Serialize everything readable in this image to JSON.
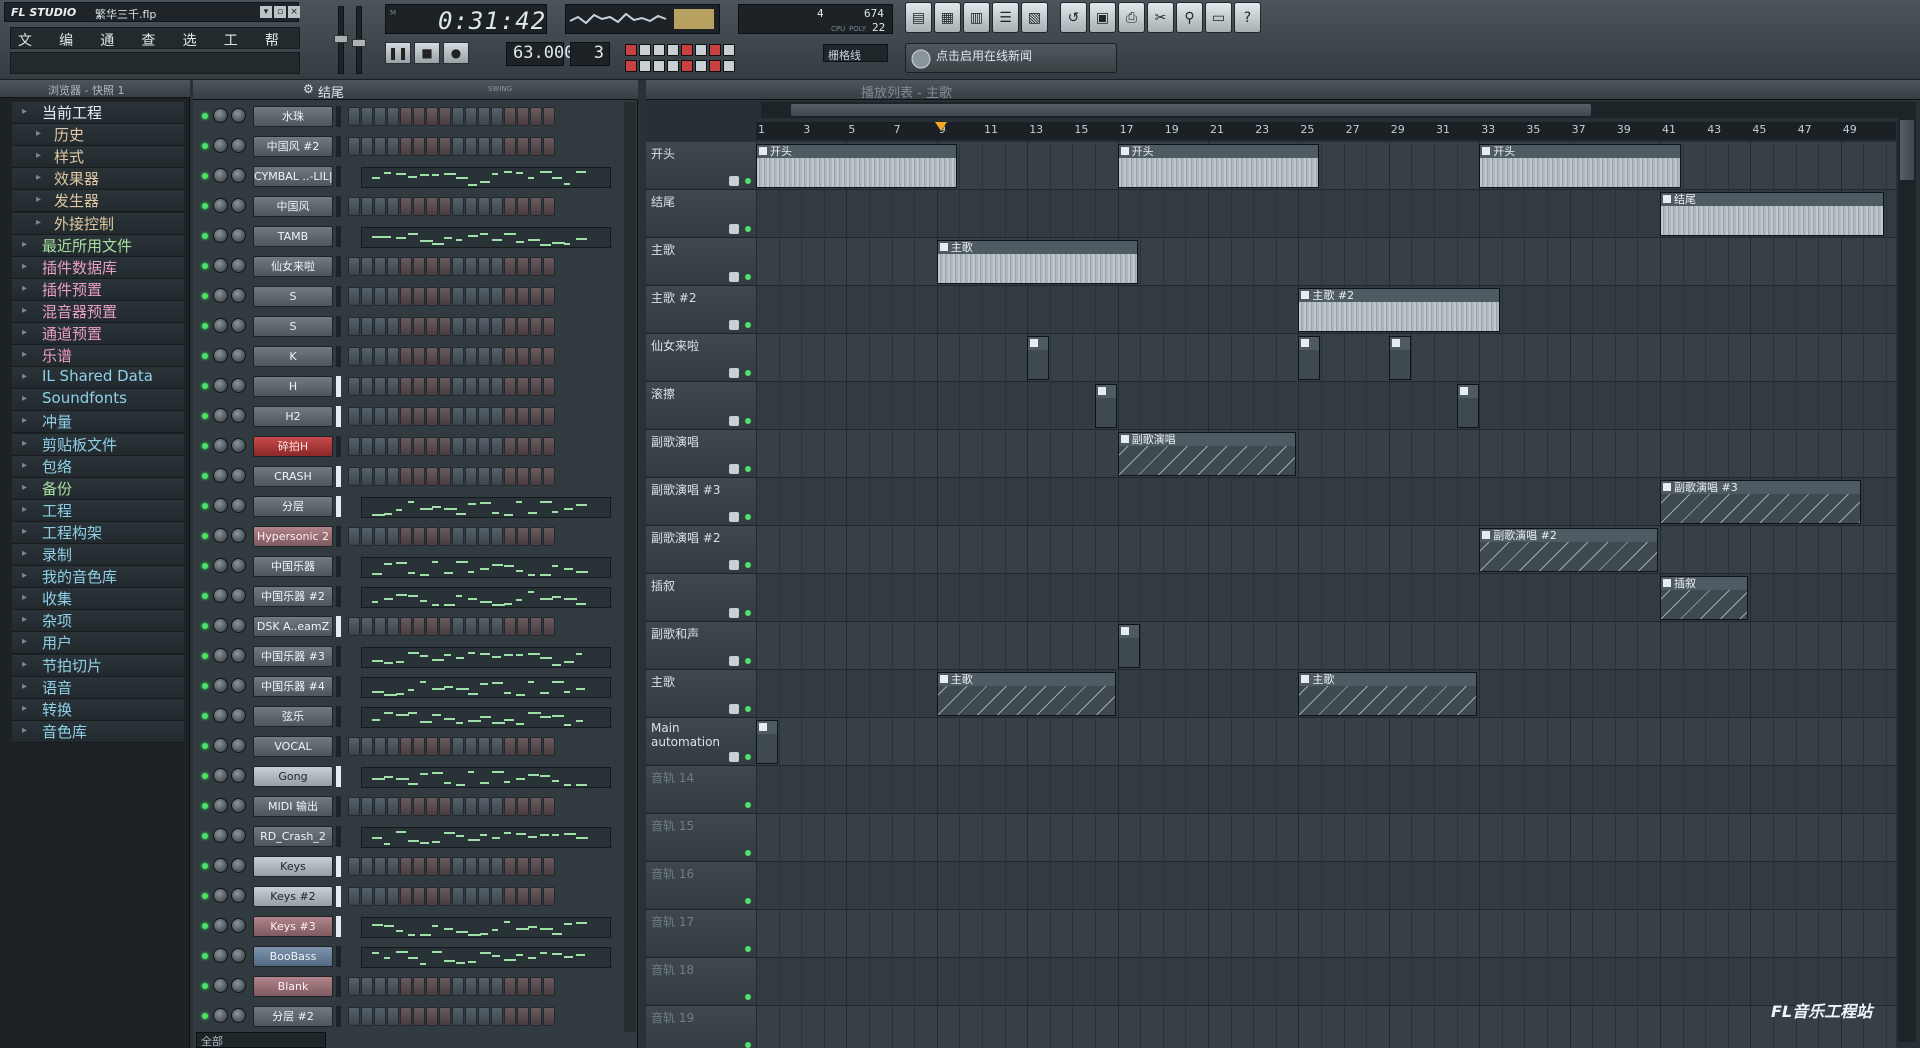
{
  "app": {
    "logo": "FL STUDIO",
    "project": "繁华三千.flp"
  },
  "menu": [
    "文件",
    "编辑",
    "通道",
    "查看",
    "选项",
    "工具",
    "帮助"
  ],
  "transport": {
    "time": "0:31:42",
    "tempo": "63.000",
    "pattern": "3",
    "tempo_label": "TEMPO",
    "pat_label": "PAT"
  },
  "cpu": {
    "a": "4",
    "b": "674",
    "c": "22",
    "mon": "MONITOR",
    "cpu_lbl": "CPU",
    "poly_lbl": "POLY"
  },
  "snap": {
    "label": "栅格线",
    "news": "点击启用在线新闻"
  },
  "browser": {
    "title": "浏览器 - 快照 1",
    "items": [
      {
        "label": "当前工程",
        "sub": false,
        "color": "#e6f0f4"
      },
      {
        "label": "历史",
        "sub": true,
        "color": "#e0c8a0"
      },
      {
        "label": "样式",
        "sub": true,
        "color": "#e0c8a0"
      },
      {
        "label": "效果器",
        "sub": true,
        "color": "#e0c8a0"
      },
      {
        "label": "发生器",
        "sub": true,
        "color": "#e0c8a0"
      },
      {
        "label": "外接控制",
        "sub": true,
        "color": "#e0c8a0"
      },
      {
        "label": "最近所用文件",
        "sub": false,
        "color": "#a8e0a0"
      },
      {
        "label": "插件数据库",
        "sub": false,
        "color": "#e8a0c0"
      },
      {
        "label": "插件预置",
        "sub": false,
        "color": "#e8a0c0"
      },
      {
        "label": "混音器预置",
        "sub": false,
        "color": "#e8a0c0"
      },
      {
        "label": "通道预置",
        "sub": false,
        "color": "#e8a0c0"
      },
      {
        "label": "乐谱",
        "sub": false,
        "color": "#e8a0c0"
      },
      {
        "label": "IL Shared Data",
        "sub": false,
        "color": "#8fd0e8"
      },
      {
        "label": "Soundfonts",
        "sub": false,
        "color": "#8fd0e8"
      },
      {
        "label": "冲量",
        "sub": false,
        "color": "#8fd0e8"
      },
      {
        "label": "剪贴板文件",
        "sub": false,
        "color": "#8fd0e8"
      },
      {
        "label": "包络",
        "sub": false,
        "color": "#8fd0e8"
      },
      {
        "label": "备份",
        "sub": false,
        "color": "#a8e0a0"
      },
      {
        "label": "工程",
        "sub": false,
        "color": "#8fd0e8"
      },
      {
        "label": "工程构架",
        "sub": false,
        "color": "#8fd0e8"
      },
      {
        "label": "录制",
        "sub": false,
        "color": "#8fd0e8"
      },
      {
        "label": "我的音色库",
        "sub": false,
        "color": "#8fd0e8"
      },
      {
        "label": "收集",
        "sub": false,
        "color": "#8fd0e8"
      },
      {
        "label": "杂项",
        "sub": false,
        "color": "#8fd0e8"
      },
      {
        "label": "用户",
        "sub": false,
        "color": "#8fd0e8"
      },
      {
        "label": "节拍切片",
        "sub": false,
        "color": "#8fd0e8"
      },
      {
        "label": "语音",
        "sub": false,
        "color": "#8fd0e8"
      },
      {
        "label": "转换",
        "sub": false,
        "color": "#8fd0e8"
      },
      {
        "label": "音色库",
        "sub": false,
        "color": "#8fd0e8"
      }
    ]
  },
  "rack": {
    "title": "结尾",
    "footer": "全部",
    "swing_label": "SWING",
    "channels": [
      {
        "name": "水珠",
        "style": "dark",
        "mode": "steps",
        "sel": false
      },
      {
        "name": "中国风 #2",
        "style": "dark",
        "mode": "steps",
        "sel": false
      },
      {
        "name": "CYMBAL ..-LIL|",
        "style": "dark",
        "mode": "roll",
        "sel": false
      },
      {
        "name": "中国风",
        "style": "dark",
        "mode": "steps",
        "sel": false
      },
      {
        "name": "TAMB",
        "style": "dark",
        "mode": "roll",
        "sel": false
      },
      {
        "name": "仙女来啦",
        "style": "dark",
        "mode": "steps",
        "sel": false
      },
      {
        "name": "S",
        "style": "dark",
        "mode": "steps",
        "sel": false
      },
      {
        "name": "S",
        "style": "dark",
        "mode": "steps",
        "sel": false
      },
      {
        "name": "K",
        "style": "dark",
        "mode": "steps",
        "sel": false
      },
      {
        "name": "H",
        "style": "dark",
        "mode": "steps",
        "sel": true
      },
      {
        "name": "H2",
        "style": "dark",
        "mode": "steps",
        "sel": true
      },
      {
        "name": "碎拍H",
        "style": "red",
        "mode": "steps",
        "sel": false
      },
      {
        "name": "CRASH",
        "style": "dark",
        "mode": "steps",
        "sel": true
      },
      {
        "name": "分层",
        "style": "dark",
        "mode": "roll",
        "sel": true
      },
      {
        "name": "Hypersonic 2",
        "style": "pink",
        "mode": "steps",
        "sel": false
      },
      {
        "name": "中国乐器",
        "style": "dark",
        "mode": "roll",
        "sel": false
      },
      {
        "name": "中国乐器 #2",
        "style": "dark",
        "mode": "roll",
        "sel": false
      },
      {
        "name": "DSK A..eamZ",
        "style": "dark",
        "mode": "steps",
        "sel": true
      },
      {
        "name": "中国乐器 #3",
        "style": "dark",
        "mode": "roll",
        "sel": false
      },
      {
        "name": "中国乐器 #4",
        "style": "dark",
        "mode": "roll",
        "sel": false
      },
      {
        "name": "弦乐",
        "style": "dark",
        "mode": "roll",
        "sel": false
      },
      {
        "name": "VOCAL",
        "style": "dark",
        "mode": "steps",
        "sel": false
      },
      {
        "name": "Gong",
        "style": "light",
        "mode": "roll",
        "sel": true
      },
      {
        "name": "MIDI 输出",
        "style": "dark",
        "mode": "steps",
        "sel": false
      },
      {
        "name": "RD_Crash_2",
        "style": "dark",
        "mode": "roll",
        "sel": false
      },
      {
        "name": "Keys",
        "style": "light",
        "mode": "steps",
        "sel": true
      },
      {
        "name": "Keys #2",
        "style": "light",
        "mode": "steps",
        "sel": true
      },
      {
        "name": "Keys #3",
        "style": "pink",
        "mode": "roll",
        "sel": true
      },
      {
        "name": "BooBass",
        "style": "blue",
        "mode": "roll",
        "sel": false
      },
      {
        "name": "Blank",
        "style": "pink",
        "mode": "steps",
        "sel": false
      },
      {
        "name": "分层 #2",
        "style": "dark",
        "mode": "steps",
        "sel": false
      }
    ]
  },
  "playlist": {
    "title": "播放列表 - 主歌",
    "ruler": [
      "1",
      "3",
      "5",
      "7",
      "9",
      "11",
      "13",
      "15",
      "17",
      "19",
      "21",
      "23",
      "25",
      "27",
      "29",
      "31",
      "33",
      "35",
      "37",
      "39",
      "41",
      "43",
      "45",
      "47",
      "49"
    ],
    "tracks": [
      {
        "name": "开头",
        "dim": false
      },
      {
        "name": "结尾",
        "dim": false
      },
      {
        "name": "主歌",
        "dim": false
      },
      {
        "name": "主歌 #2",
        "dim": false
      },
      {
        "name": "仙女来啦",
        "dim": false
      },
      {
        "name": "滚擦",
        "dim": false
      },
      {
        "name": "副歌演唱",
        "dim": false
      },
      {
        "name": "副歌演唱 #3",
        "dim": false
      },
      {
        "name": "副歌演唱 #2",
        "dim": false
      },
      {
        "name": "插叙",
        "dim": false
      },
      {
        "name": "副歌和声",
        "dim": false
      },
      {
        "name": "主歌",
        "dim": false
      },
      {
        "name": "Main automation",
        "dim": false
      },
      {
        "name": "音轨 14",
        "dim": true
      },
      {
        "name": "音轨 15",
        "dim": true
      },
      {
        "name": "音轨 16",
        "dim": true
      },
      {
        "name": "音轨 17",
        "dim": true
      },
      {
        "name": "音轨 18",
        "dim": true
      },
      {
        "name": "音轨 19",
        "dim": true
      }
    ],
    "clips": [
      {
        "track": 0,
        "start": 1,
        "len": 9,
        "label": "开头",
        "kind": "audio"
      },
      {
        "track": 0,
        "start": 17,
        "len": 9,
        "label": "开头",
        "kind": "audio"
      },
      {
        "track": 0,
        "start": 33,
        "len": 9,
        "label": "开头",
        "kind": "audio"
      },
      {
        "track": 1,
        "start": 41,
        "len": 10,
        "label": "结尾",
        "kind": "audio"
      },
      {
        "track": 2,
        "start": 9,
        "len": 9,
        "label": "主歌",
        "kind": "audio"
      },
      {
        "track": 3,
        "start": 25,
        "len": 9,
        "label": "主歌 #2",
        "kind": "audio"
      },
      {
        "track": 4,
        "start": 13,
        "len": 1,
        "label": "",
        "kind": "small"
      },
      {
        "track": 4,
        "start": 25,
        "len": 1,
        "label": "",
        "kind": "small"
      },
      {
        "track": 4,
        "start": 29,
        "len": 1,
        "label": "",
        "kind": "small"
      },
      {
        "track": 5,
        "start": 16,
        "len": 1,
        "label": "",
        "kind": "small"
      },
      {
        "track": 5,
        "start": 32,
        "len": 1,
        "label": "",
        "kind": "small"
      },
      {
        "track": 6,
        "start": 17,
        "len": 8,
        "label": "副歌演唱",
        "kind": "notes"
      },
      {
        "track": 7,
        "start": 41,
        "len": 9,
        "label": "副歌演唱 #3",
        "kind": "notes"
      },
      {
        "track": 8,
        "start": 33,
        "len": 8,
        "label": "副歌演唱 #2",
        "kind": "notes"
      },
      {
        "track": 9,
        "start": 41,
        "len": 4,
        "label": "插叙",
        "kind": "notes"
      },
      {
        "track": 10,
        "start": 17,
        "len": 1,
        "label": "",
        "kind": "small"
      },
      {
        "track": 11,
        "start": 9,
        "len": 8,
        "label": "主歌",
        "kind": "notes"
      },
      {
        "track": 11,
        "start": 25,
        "len": 8,
        "label": "主歌",
        "kind": "notes"
      },
      {
        "track": 12,
        "start": 1,
        "len": 1,
        "label": "",
        "kind": "small"
      }
    ]
  },
  "watermark": "FL音乐工程站"
}
